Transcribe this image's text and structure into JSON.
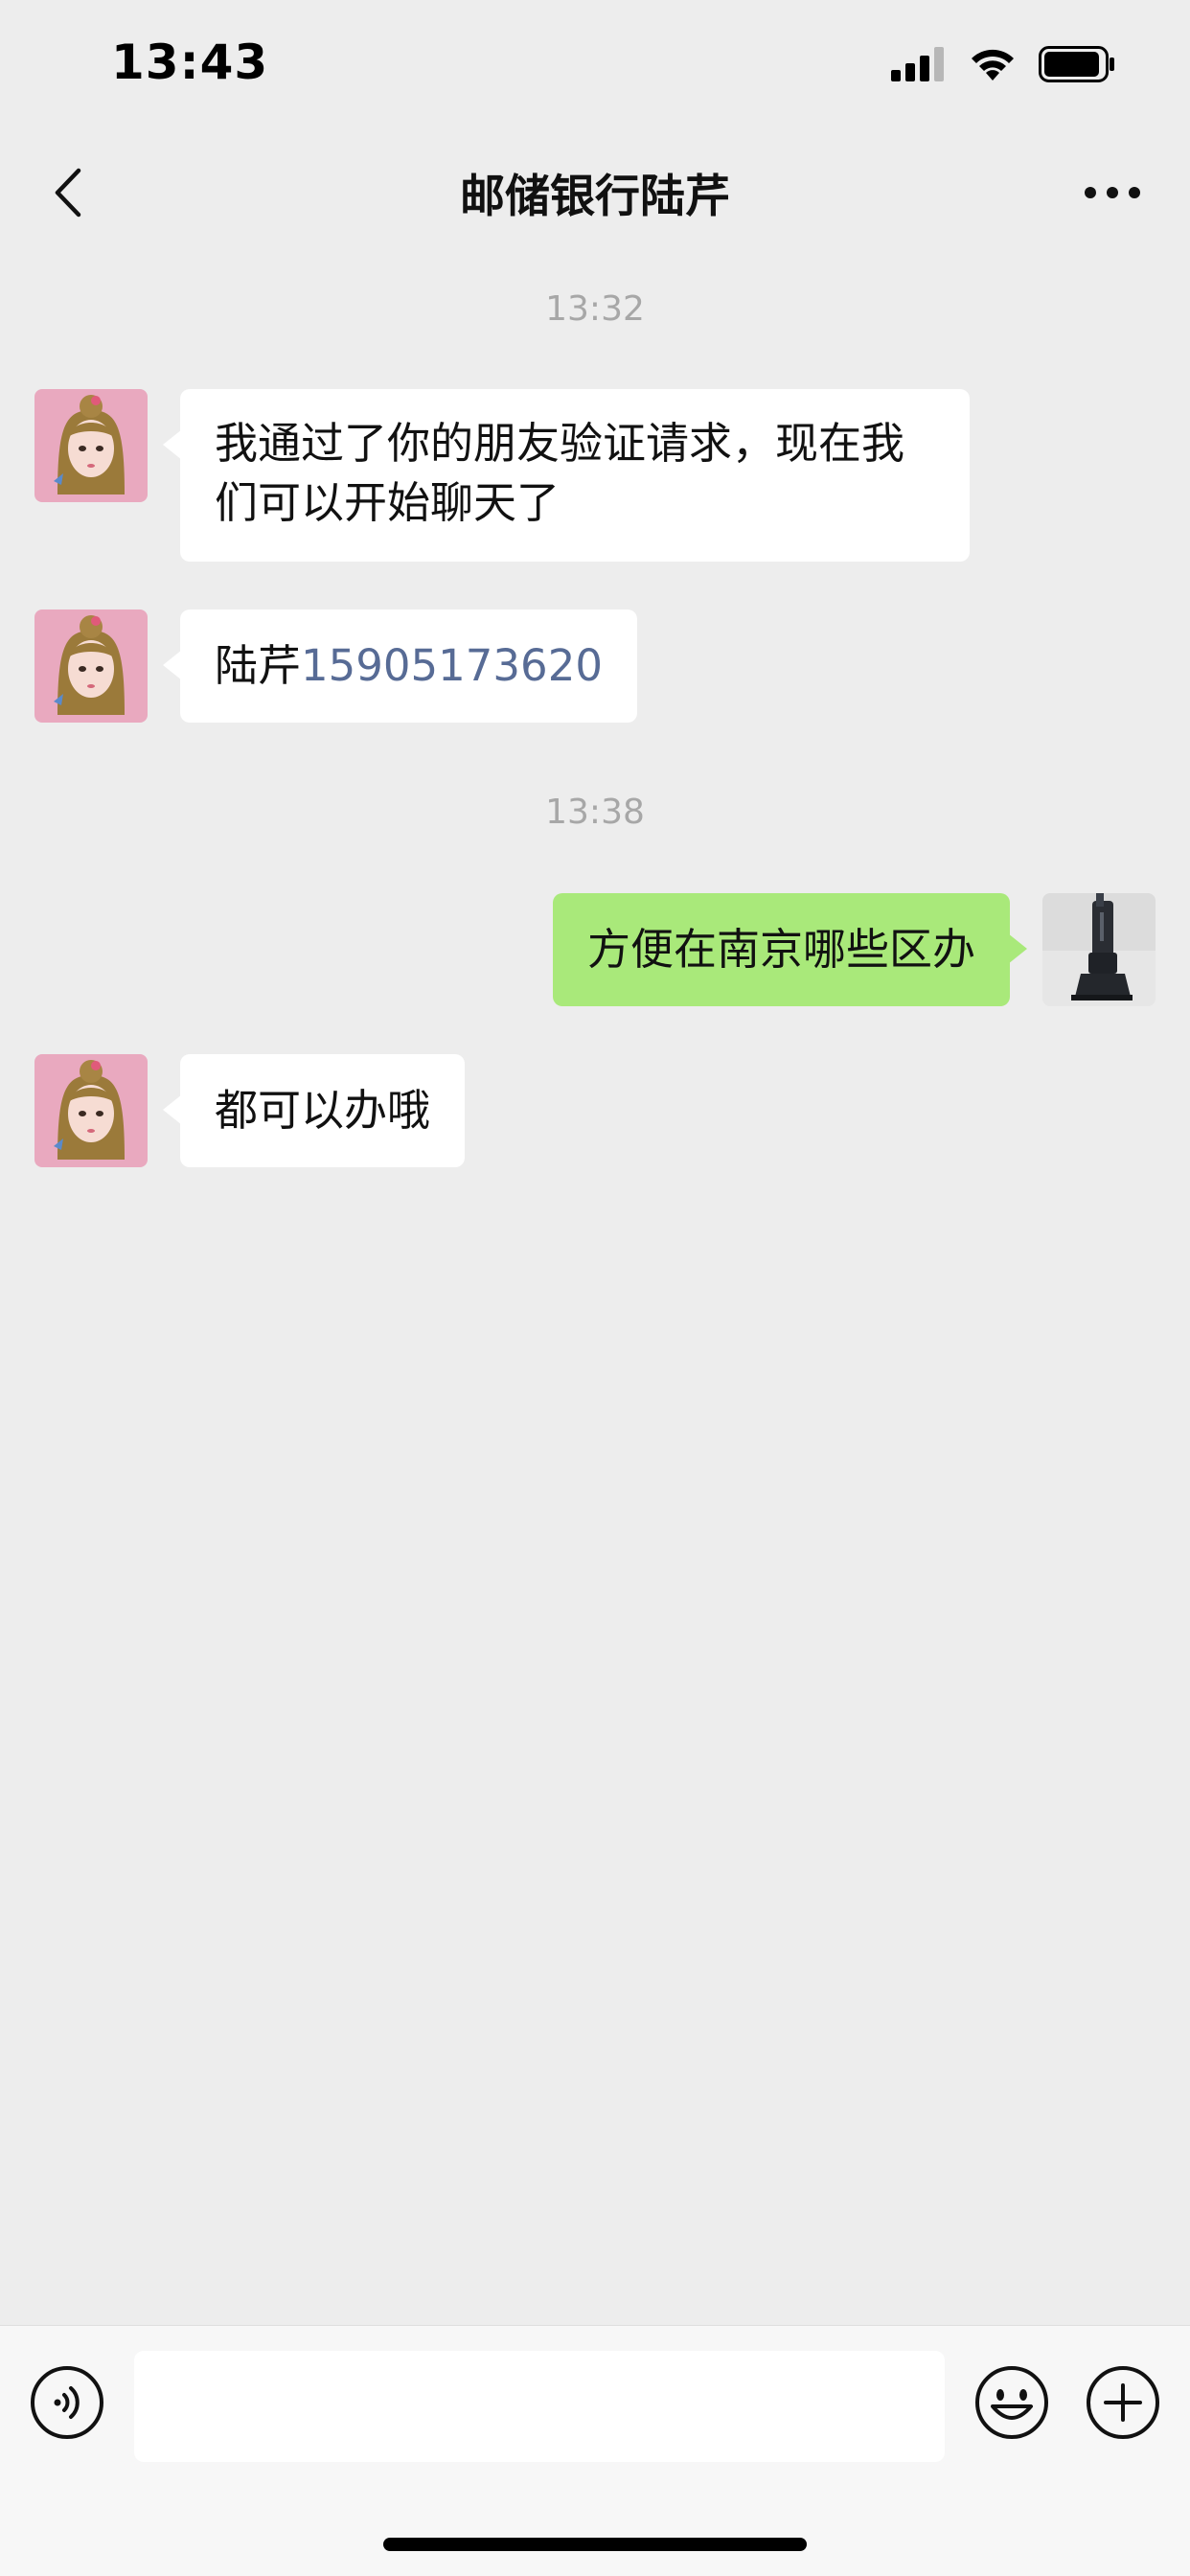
{
  "status_bar": {
    "time": "13:43"
  },
  "nav": {
    "title": "邮储银行陆芹"
  },
  "messages": {
    "timestamp_1": "13:32",
    "msg_1": "我通过了你的朋友验证请求，现在我们可以开始聊天了",
    "msg_2_name": "陆芹",
    "msg_2_phone": "15905173620",
    "timestamp_2": "13:38",
    "msg_3": "方便在南京哪些区办",
    "msg_4": "都可以办哦"
  },
  "colors": {
    "background": "#ededed",
    "bubble_incoming": "#ffffff",
    "bubble_outgoing": "#a9e97a",
    "link": "#576b95",
    "timestamp": "#a7a7a7"
  },
  "icons": {
    "back": "chevron-left-icon",
    "more": "more-dots-icon",
    "voice": "voice-icon",
    "emoji": "emoji-icon",
    "plus": "plus-icon"
  }
}
